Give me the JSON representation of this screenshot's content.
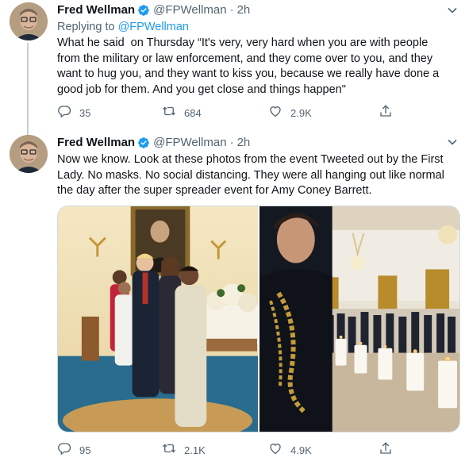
{
  "tweets": [
    {
      "author_name": "Fred Wellman",
      "handle": "@FPWellman",
      "time": "2h",
      "replying_prefix": "Replying to ",
      "replying_to": "@FPWellman",
      "text": "What he said  on Thursday “It's very, very hard when you are with people\nfrom the military or law enforcement, and they come over to you, and they\nwant to hug you, and they want to kiss you, because we really have done a\ngood job for them. And you get close and things happen\"",
      "replies": "35",
      "retweets": "684",
      "likes": "2.9K"
    },
    {
      "author_name": "Fred Wellman",
      "handle": "@FPWellman",
      "time": "2h",
      "text": "Now we know. Look at these photos from the event Tweeted out by the First\nLady. No masks. No social distancing. They were all hanging out like normal\nthe day after the super spreader event for Amy Coney Barrett.",
      "replies": "95",
      "retweets": "2.1K",
      "likes": "4.9K"
    }
  ],
  "icons": {
    "verified": "verified-badge-icon",
    "reply": "reply-icon",
    "retweet": "retweet-icon",
    "like": "heart-icon",
    "share": "share-icon",
    "more": "chevron-down-icon"
  },
  "colors": {
    "accent": "#1d9bf0",
    "secondary_text": "#536471",
    "primary_text": "#0f1419",
    "thread_line": "#c4cfd6"
  }
}
